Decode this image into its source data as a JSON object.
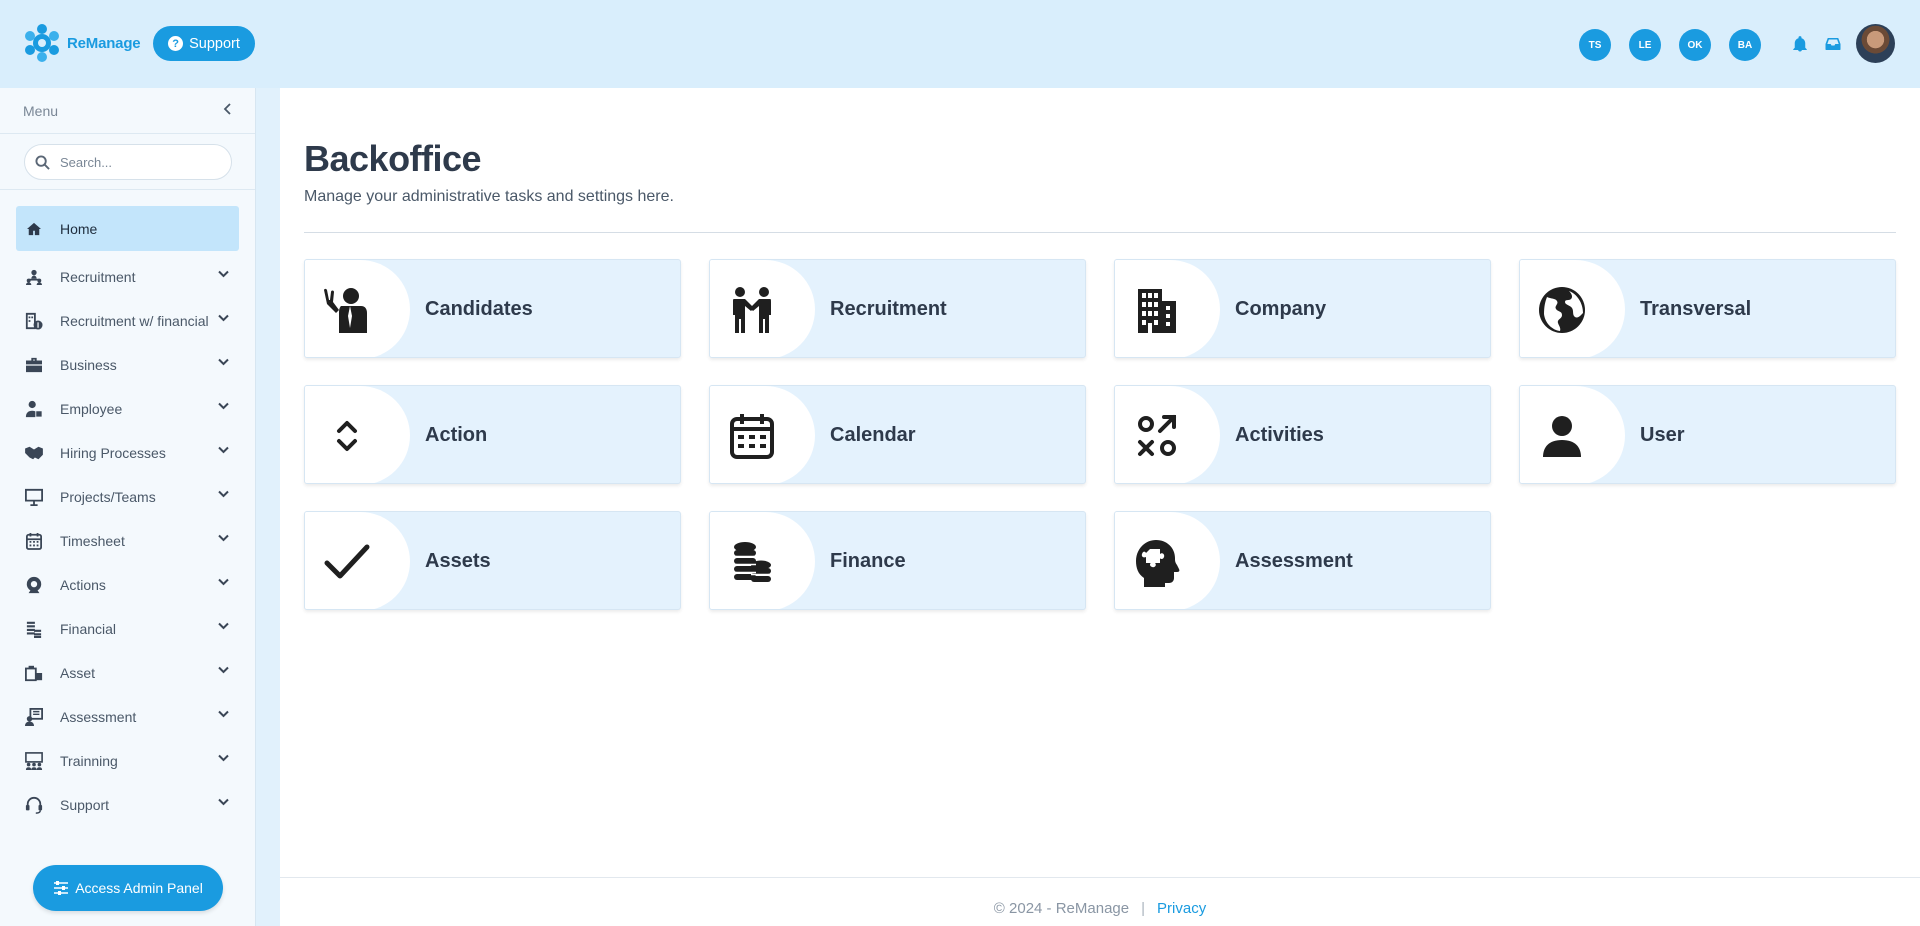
{
  "brand": {
    "name_prefix": "Re",
    "name_suffix": "Manage"
  },
  "header": {
    "support_label": "Support",
    "user_chips": [
      "TS",
      "LE",
      "OK",
      "BA"
    ],
    "icons": [
      "bell-icon",
      "inbox-icon"
    ]
  },
  "sidebar": {
    "menu_label": "Menu",
    "search_placeholder": "Search...",
    "items": [
      {
        "label": "Home",
        "icon": "home-icon",
        "active": true
      },
      {
        "label": "Recruitment",
        "icon": "sitemap-users-icon"
      },
      {
        "label": "Recruitment w/ financial",
        "icon": "building-dollar-icon"
      },
      {
        "label": "Business",
        "icon": "briefcase-icon"
      },
      {
        "label": "Employee",
        "icon": "user-tie-icon"
      },
      {
        "label": "Hiring Processes",
        "icon": "handshake-icon"
      },
      {
        "label": "Projects/Teams",
        "icon": "presentation-icon"
      },
      {
        "label": "Timesheet",
        "icon": "calendar-icon"
      },
      {
        "label": "Actions",
        "icon": "actions-icon"
      },
      {
        "label": "Financial",
        "icon": "coins-icon"
      },
      {
        "label": "Asset",
        "icon": "asset-icon"
      },
      {
        "label": "Assessment",
        "icon": "assessment-icon"
      },
      {
        "label": "Trainning",
        "icon": "training-icon"
      },
      {
        "label": "Support",
        "icon": "headset-icon"
      }
    ],
    "admin_button": "Access Admin Panel"
  },
  "main": {
    "title": "Backoffice",
    "subtitle": "Manage your administrative tasks and settings here.",
    "cards": [
      {
        "label": "Candidates",
        "icon": "person-waving-icon"
      },
      {
        "label": "Recruitment",
        "icon": "people-handshake-icon"
      },
      {
        "label": "Company",
        "icon": "building-icon"
      },
      {
        "label": "Transversal",
        "icon": "globe-icon"
      },
      {
        "label": "Action",
        "icon": "up-down-arrows-icon"
      },
      {
        "label": "Calendar",
        "icon": "calendar-icon"
      },
      {
        "label": "Activities",
        "icon": "strategy-icon"
      },
      {
        "label": "User",
        "icon": "user-icon"
      },
      {
        "label": "Assets",
        "icon": "checkmark-icon"
      },
      {
        "label": "Finance",
        "icon": "coins-icon"
      },
      {
        "label": "Assessment",
        "icon": "head-puzzle-icon"
      }
    ]
  },
  "footer": {
    "copyright": "© 2024 - ReManage",
    "separator": "|",
    "privacy": "Privacy"
  }
}
